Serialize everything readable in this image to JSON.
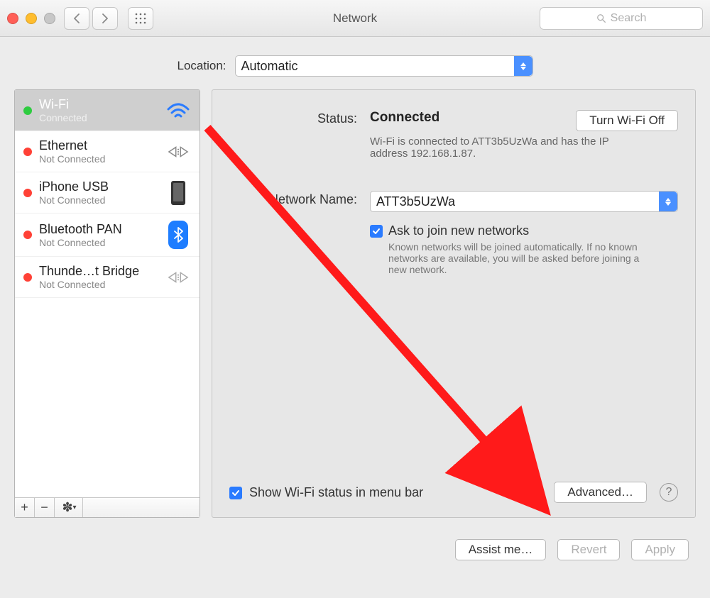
{
  "window": {
    "title": "Network",
    "search_placeholder": "Search"
  },
  "location": {
    "label": "Location:",
    "value": "Automatic"
  },
  "services": [
    {
      "name": "Wi-Fi",
      "status": "Connected",
      "kind": "wifi",
      "dot": "green",
      "selected": true
    },
    {
      "name": "Ethernet",
      "status": "Not Connected",
      "kind": "ethernet",
      "dot": "red",
      "selected": false
    },
    {
      "name": "iPhone USB",
      "status": "Not Connected",
      "kind": "phone",
      "dot": "red",
      "selected": false
    },
    {
      "name": "Bluetooth PAN",
      "status": "Not Connected",
      "kind": "bluetooth",
      "dot": "red",
      "selected": false
    },
    {
      "name": "Thunde…t Bridge",
      "status": "Not Connected",
      "kind": "ethernet",
      "dot": "red",
      "selected": false
    }
  ],
  "detail": {
    "status_label": "Status:",
    "status_value": "Connected",
    "wifi_toggle": "Turn Wi-Fi Off",
    "status_desc": "Wi-Fi is connected to ATT3b5UzWa and has the IP address 192.168.1.87.",
    "network_name_label": "Network Name:",
    "network_name_value": "ATT3b5UzWa",
    "ask_join": "Ask to join new networks",
    "ask_join_desc": "Known networks will be joined automatically. If no known networks are available, you will be asked before joining a new network.",
    "show_menubar": "Show Wi-Fi status in menu bar",
    "advanced": "Advanced…"
  },
  "footer": {
    "assist": "Assist me…",
    "revert": "Revert",
    "apply": "Apply"
  }
}
